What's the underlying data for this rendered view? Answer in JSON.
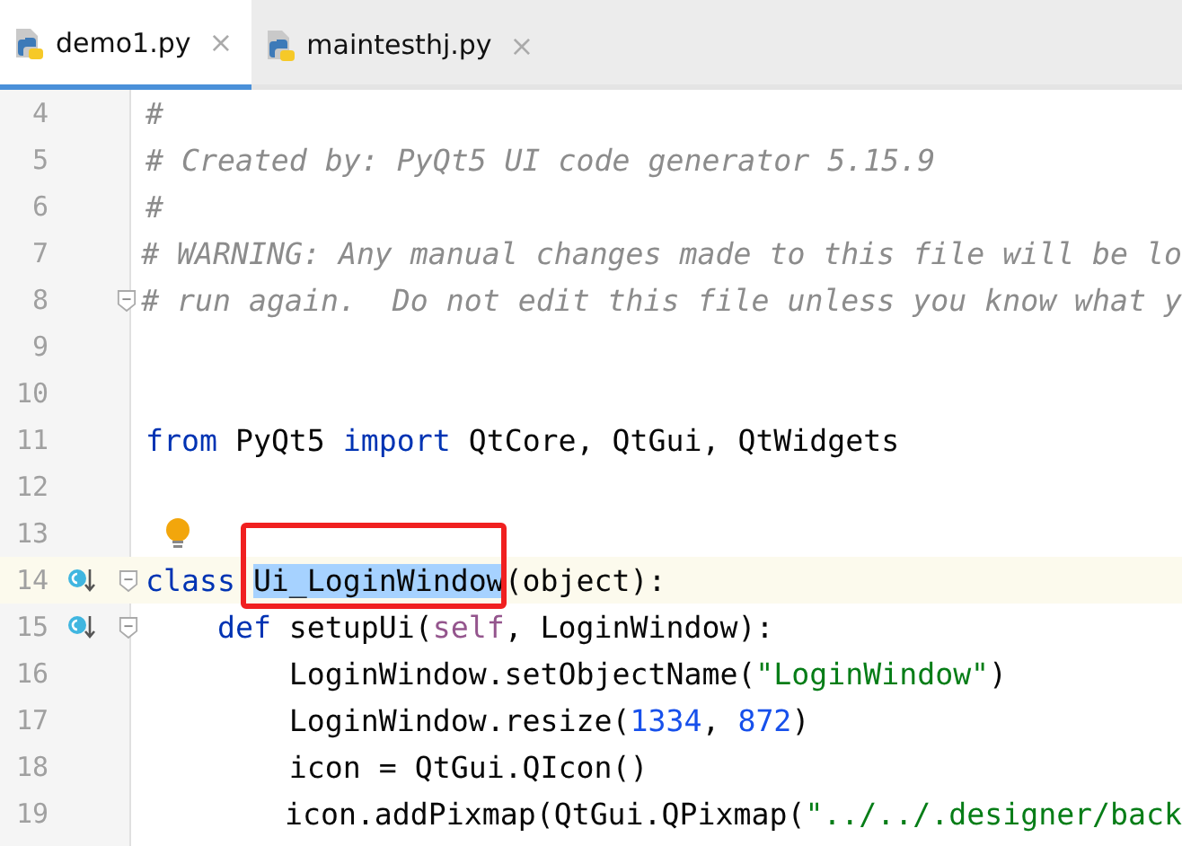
{
  "tabs": [
    {
      "label": "demo1.py",
      "close": "×",
      "selected": true
    },
    {
      "label": "maintesthj.py",
      "close": "×",
      "selected": false
    }
  ],
  "lines": [
    {
      "number": "4",
      "current": false,
      "fold": false,
      "tokens": [
        {
          "kind": "comment",
          "text": "#"
        }
      ]
    },
    {
      "number": "5",
      "current": false,
      "fold": false,
      "tokens": [
        {
          "kind": "comment",
          "text": "# Created by: PyQt5 UI code generator 5.15.9"
        }
      ]
    },
    {
      "number": "6",
      "current": false,
      "fold": false,
      "tokens": [
        {
          "kind": "comment",
          "text": "#"
        }
      ]
    },
    {
      "number": "7",
      "current": false,
      "fold": false,
      "tokens": [
        {
          "kind": "comment",
          "text": "# WARNING: Any manual changes made to this file will be lo"
        }
      ]
    },
    {
      "number": "8",
      "current": false,
      "fold": true,
      "tokens": [
        {
          "kind": "comment",
          "text": "# run again.  Do not edit this file unless you know what y"
        }
      ]
    },
    {
      "number": "9",
      "current": false,
      "fold": false
    },
    {
      "number": "10",
      "current": false,
      "fold": false
    },
    {
      "number": "11",
      "current": false,
      "fold": false,
      "tokens": [
        {
          "kind": "keyword",
          "text": "from"
        },
        {
          "kind": "plain",
          "text": " PyQt5 "
        },
        {
          "kind": "keyword",
          "text": "import"
        },
        {
          "kind": "plain",
          "text": " QtCore, QtGui, QtWidgets"
        }
      ]
    },
    {
      "number": "12",
      "current": false,
      "fold": false
    },
    {
      "number": "13",
      "current": false,
      "fold": false,
      "bulb": true
    },
    {
      "number": "14",
      "current": true,
      "fold": true,
      "override": true,
      "tokens": [
        {
          "kind": "keyword",
          "text": "class"
        },
        {
          "kind": "selected",
          "text": "Ui_LoginWindow",
          "space_before": true,
          "framed": true
        },
        {
          "kind": "plain",
          "text": "(object):"
        }
      ]
    },
    {
      "number": "15",
      "current": false,
      "fold": true,
      "override": true,
      "tokens": [
        {
          "kind": "keyword",
          "text": "    def"
        },
        {
          "kind": "plain",
          "text": " setupUi("
        },
        {
          "kind": "self",
          "text": "self"
        },
        {
          "kind": "plain",
          "text": ", LoginWindow):"
        }
      ]
    },
    {
      "number": "16",
      "current": false,
      "fold": false,
      "tokens": [
        {
          "kind": "plain",
          "text": "        LoginWindow.setObjectName("
        },
        {
          "kind": "string",
          "text": "\"LoginWindow\""
        },
        {
          "kind": "plain",
          "text": ")"
        }
      ]
    },
    {
      "number": "17",
      "current": false,
      "fold": false,
      "tokens": [
        {
          "kind": "plain",
          "text": "        LoginWindow.resize("
        },
        {
          "kind": "number",
          "text": "1334"
        },
        {
          "kind": "plain",
          "text": ", "
        },
        {
          "kind": "number",
          "text": "872"
        },
        {
          "kind": "plain",
          "text": ")"
        }
      ]
    },
    {
      "number": "18",
      "current": false,
      "fold": false,
      "tokens": [
        {
          "kind": "plain",
          "text": "        icon = QtGui.QIcon()"
        }
      ]
    },
    {
      "number": "19",
      "current": false,
      "fold": false,
      "tokens": [
        {
          "kind": "plain",
          "text": "        icon.addPixmap(QtGui.QPixmap("
        },
        {
          "kind": "string",
          "text": "\"../../.designer/back"
        }
      ]
    }
  ]
}
